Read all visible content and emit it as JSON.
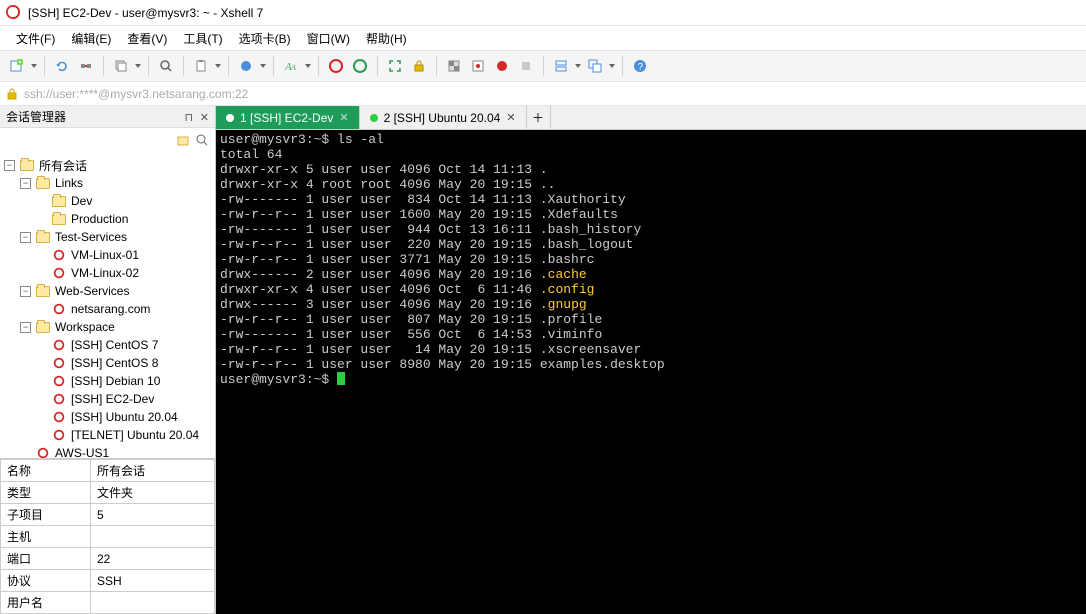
{
  "title": "[SSH] EC2-Dev - user@mysvr3: ~ - Xshell 7",
  "menu": [
    "文件(F)",
    "编辑(E)",
    "查看(V)",
    "工具(T)",
    "选项卡(B)",
    "窗口(W)",
    "帮助(H)"
  ],
  "address": "ssh://user:****@mysvr3.netsarang.com:22",
  "sidebar": {
    "title": "会话管理器",
    "tree": {
      "root": "所有会话",
      "links": "Links",
      "dev": "Dev",
      "production": "Production",
      "test": "Test-Services",
      "vm1": "VM-Linux-01",
      "vm2": "VM-Linux-02",
      "web": "Web-Services",
      "net": "netsarang.com",
      "ws": "Workspace",
      "c7": "[SSH] CentOS 7",
      "c8": "[SSH] CentOS 8",
      "d10": "[SSH] Debian 10",
      "ec2": "[SSH] EC2-Dev",
      "u20": "[SSH] Ubuntu 20.04",
      "tel": "[TELNET] Ubuntu 20.04",
      "aws": "AWS-US1"
    }
  },
  "props": {
    "headers": [
      "名称",
      "类型",
      "子项目",
      "主机",
      "端口",
      "协议",
      "用户名"
    ],
    "values": [
      "所有会话",
      "文件夹",
      "5",
      "",
      "22",
      "SSH",
      ""
    ]
  },
  "tabs": {
    "t1": "1 [SSH] EC2-Dev",
    "t2": "2 [SSH] Ubuntu 20.04"
  },
  "terminal": {
    "prompt1": "user@mysvr3:~$ ",
    "cmd": "ls -al",
    "lines": [
      "total 64",
      "drwxr-xr-x 5 user user 4096 Oct 14 11:13 .",
      "drwxr-xr-x 4 root root 4096 May 20 19:15 ..",
      "-rw------- 1 user user  834 Oct 14 11:13 .Xauthority",
      "-rw-r--r-- 1 user user 1600 May 20 19:15 .Xdefaults",
      "-rw------- 1 user user  944 Oct 13 16:11 .bash_history",
      "-rw-r--r-- 1 user user  220 May 20 19:15 .bash_logout",
      "-rw-r--r-- 1 user user 3771 May 20 19:15 .bashrc"
    ],
    "dcache_pre": "drwx------ 2 user user 4096 May 20 19:16 ",
    "dcache": ".cache",
    "dconfig_pre": "drwxr-xr-x 4 user user 4096 Oct  6 11:46 ",
    "dconfig": ".config",
    "dgnupg_pre": "drwx------ 3 user user 4096 May 20 19:16 ",
    "dgnupg": ".gnupg",
    "lines2": [
      "-rw-r--r-- 1 user user  807 May 20 19:15 .profile",
      "-rw------- 1 user user  556 Oct  6 14:53 .viminfo",
      "-rw-r--r-- 1 user user   14 May 20 19:15 .xscreensaver",
      "-rw-r--r-- 1 user user 8980 May 20 19:15 examples.desktop"
    ],
    "prompt2": "user@mysvr3:~$ "
  }
}
